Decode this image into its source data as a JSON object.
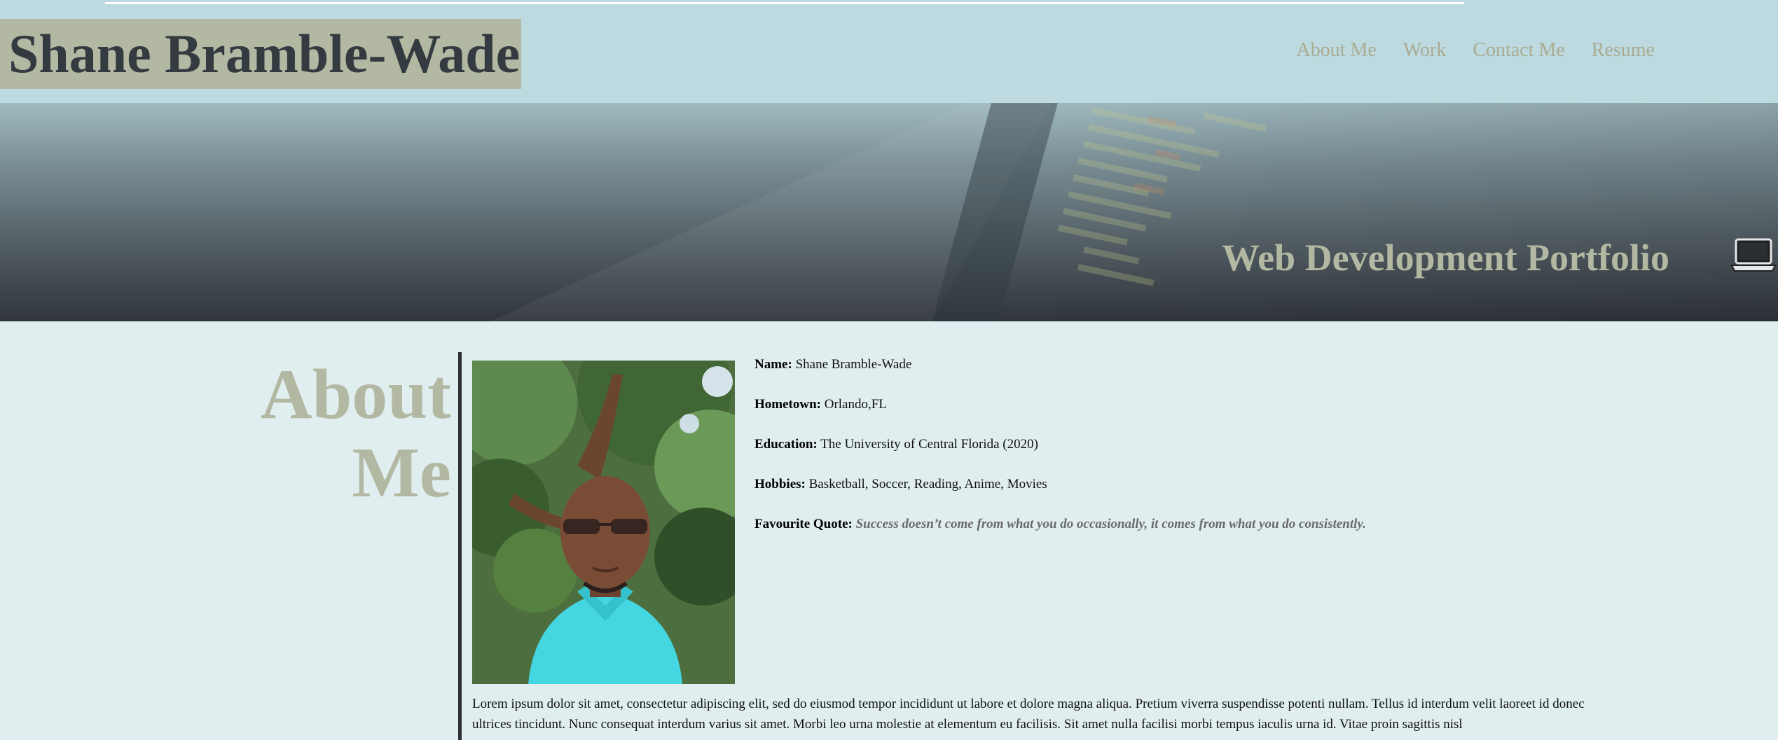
{
  "header": {
    "brand": "Shane Bramble-Wade",
    "nav": [
      "About Me",
      "Work",
      "Contact Me",
      "Resume"
    ]
  },
  "hero": {
    "title": "Web Development Portfolio",
    "icon": "laptop-icon"
  },
  "about": {
    "heading_line1": "About",
    "heading_line2": "Me",
    "photo_icon": "profile-photo",
    "fields": {
      "name_label": "Name:",
      "name_value": "Shane Bramble-Wade",
      "hometown_label": "Hometown:",
      "hometown_value": "Orlando,FL",
      "education_label": "Education:",
      "education_value": "The University of Central Florida (2020)",
      "hobbies_label": "Hobbies:",
      "hobbies_value": "Basketball, Soccer, Reading, Anime, Movies",
      "quote_label": "Favourite Quote:",
      "quote_value": "Success doesn’t come from what you do occasionally, it comes from what you do consistently."
    },
    "bio": "Lorem ipsum dolor sit amet, consectetur adipiscing elit, sed do eiusmod tempor incididunt ut labore et dolore magna aliqua. Pretium viverra suspendisse potenti nullam. Tellus id interdum velit laoreet id donec ultrices tincidunt. Nunc consequat interdum varius sit amet. Morbi leo urna molestie at elementum eu facilisis. Sit amet nulla facilisi morbi tempus iaculis urna id. Vitae proin sagittis nisl"
  },
  "colors": {
    "header_bg": "#bcdadf",
    "page_bg": "#e0eef0",
    "brand_bg": "#b3b8a2",
    "brand_text": "#333a40",
    "accent_khaki": "#b3b8a2",
    "nav_text": "#a9ab92",
    "divider": "#2d3136"
  }
}
